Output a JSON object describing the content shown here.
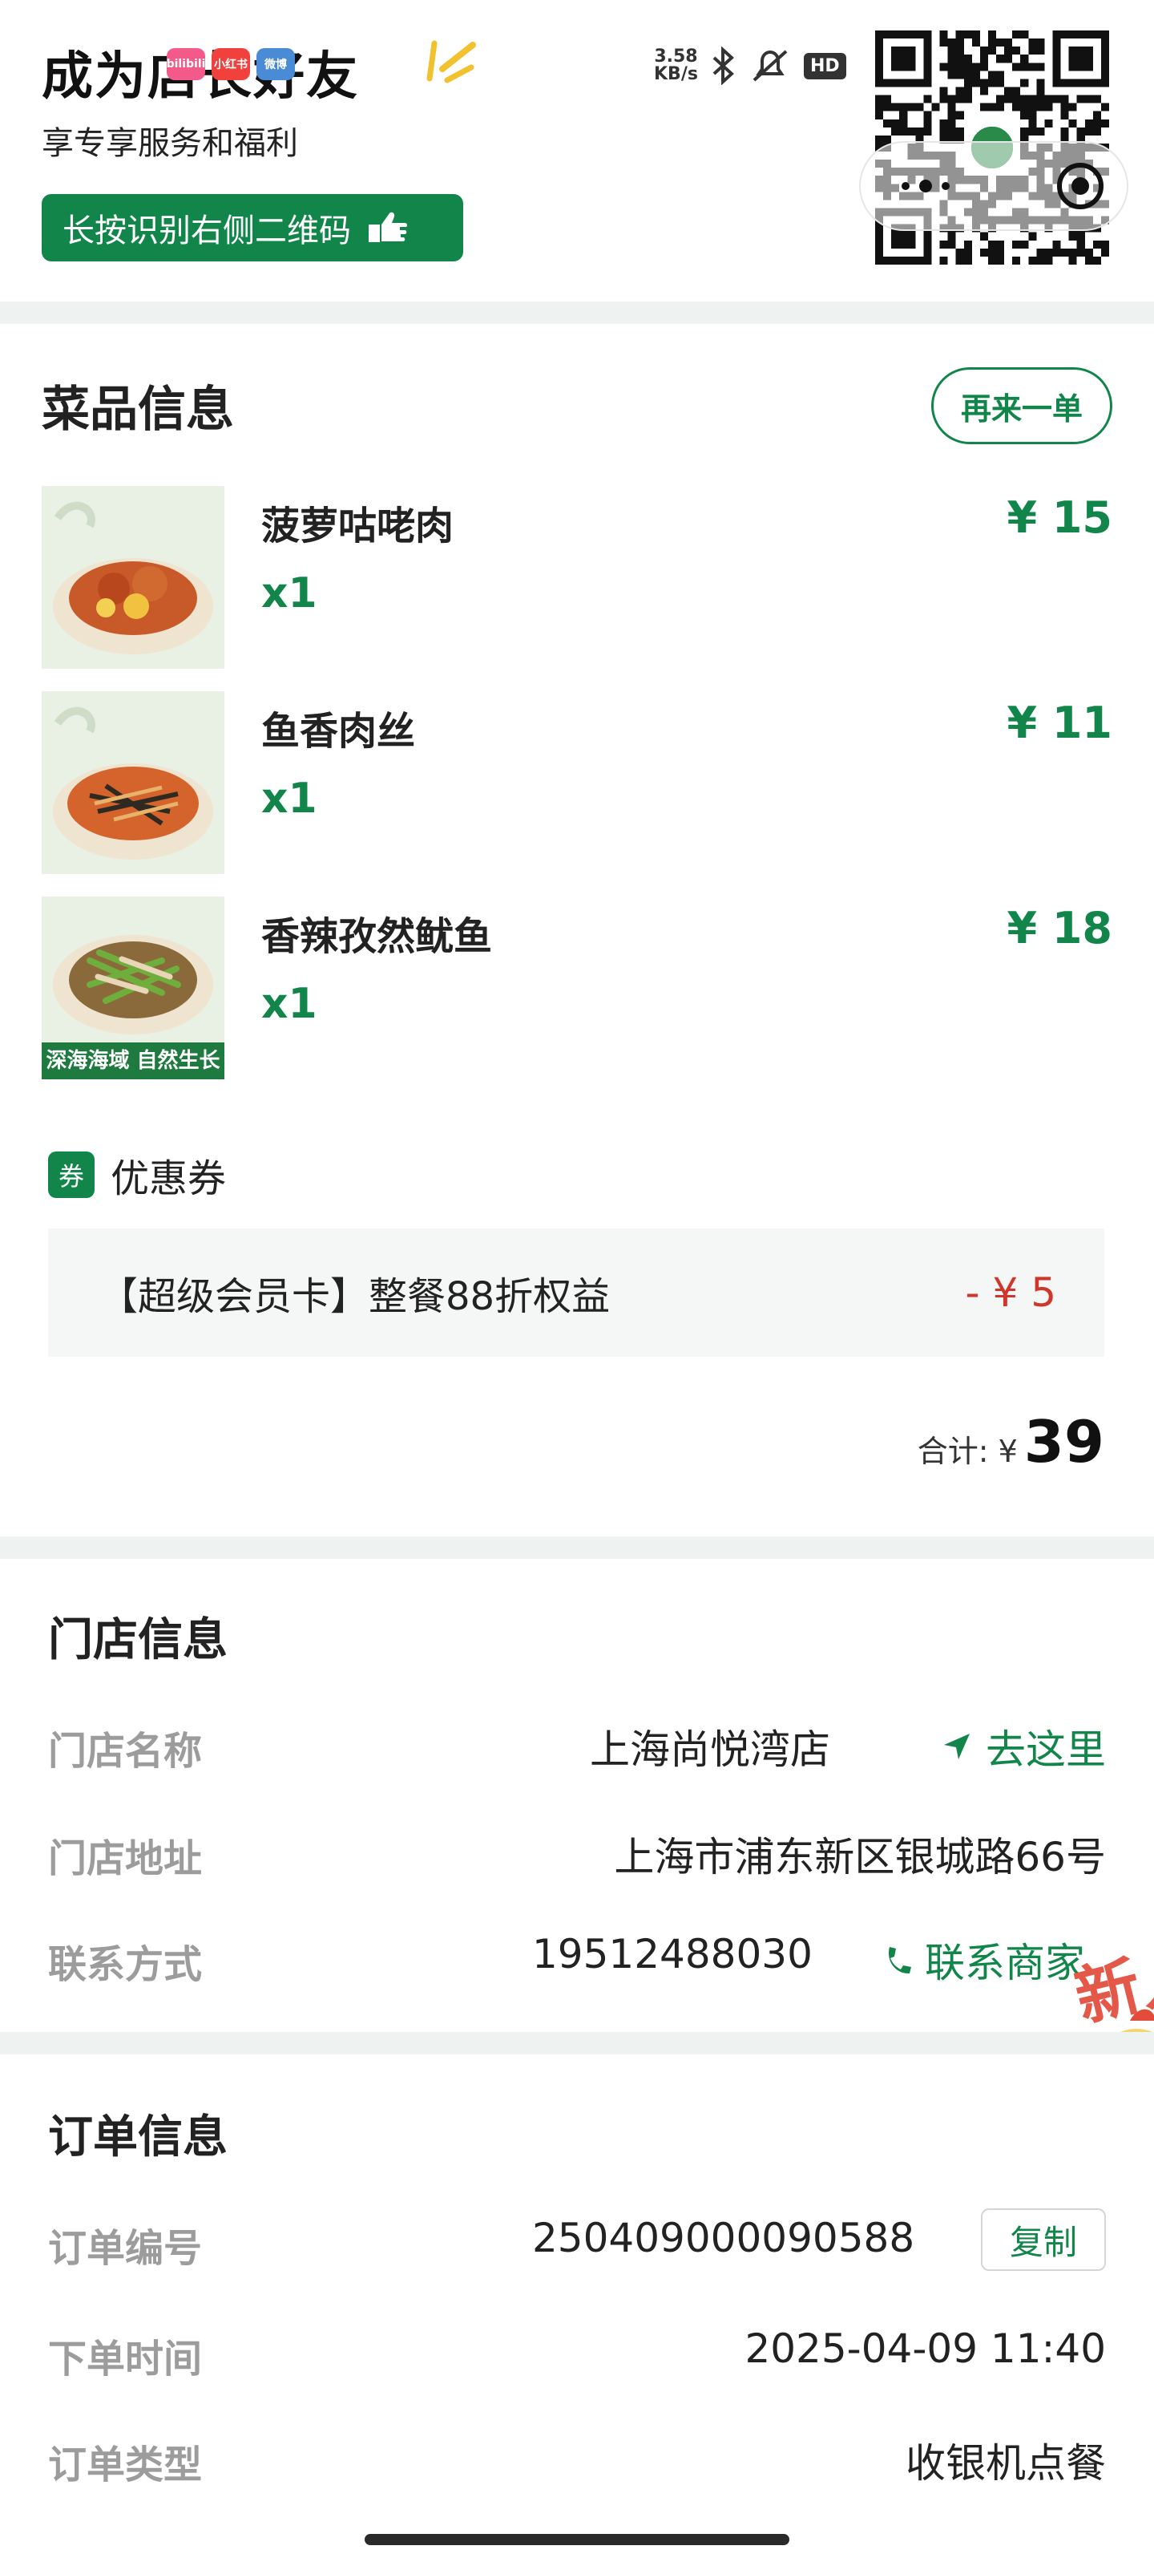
{
  "header": {
    "title": "成为店长好友",
    "subtitle": "享专享服务和福利",
    "button_label": "长按识别右侧二维码",
    "app_badges": [
      "bilibili",
      "小红书",
      "微博"
    ],
    "status": {
      "net_speed_value": "3.58",
      "net_speed_unit": "KB/s",
      "hd_label": "HD"
    }
  },
  "dishes": {
    "section_title": "菜品信息",
    "reorder_label": "再来一单",
    "items": [
      {
        "name": "菠萝咕咾肉",
        "qty": "x1",
        "price": "¥ 15"
      },
      {
        "name": "鱼香肉丝",
        "qty": "x1",
        "price": "¥ 11"
      },
      {
        "name": "香辣孜然鱿鱼",
        "qty": "x1",
        "price": "¥ 18",
        "image_caption": "深海海域 自然生长"
      }
    ]
  },
  "coupon": {
    "icon_label": "券",
    "label": "优惠券",
    "name": "【超级会员卡】整餐88折权益",
    "amount": "- ¥ 5"
  },
  "total": {
    "label": "合计: ¥",
    "value": "39"
  },
  "store": {
    "section_title": "门店信息",
    "name_label": "门店名称",
    "name_value": "上海尚悦湾店",
    "navigate_label": "去这里",
    "address_label": "门店地址",
    "address_value": "上海市浦东新区银城路66号",
    "contact_label": "联系方式",
    "contact_value": "19512488030",
    "contact_action": "联系商家",
    "mascot_text": "新人"
  },
  "order": {
    "section_title": "订单信息",
    "number_label": "订单编号",
    "number_value": "250409000090588",
    "copy_label": "复制",
    "time_label": "下单时间",
    "time_value": "2025-04-09 11:40",
    "type_label": "订单类型",
    "type_value": "收银机点餐"
  },
  "colors": {
    "brand_green": "#12864a",
    "discount_red": "#d0362b",
    "divider": "#eef3f2"
  }
}
